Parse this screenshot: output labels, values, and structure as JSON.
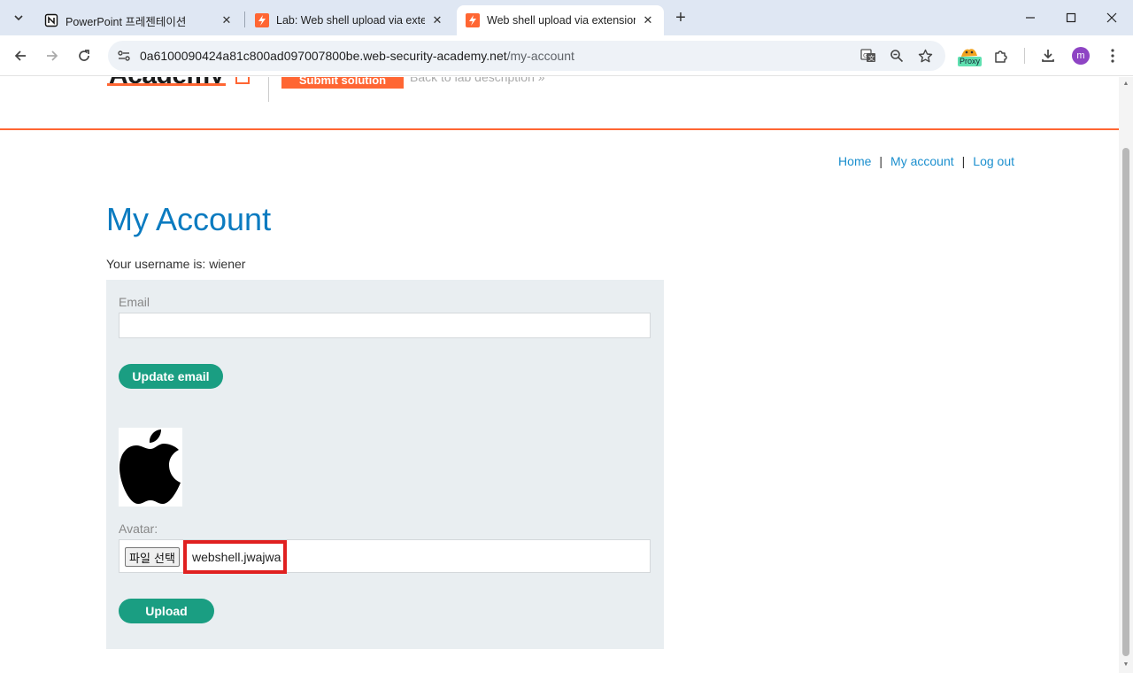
{
  "browser": {
    "tabs": [
      {
        "title": "PowerPoint 프레젠테이션"
      },
      {
        "title": "Lab: Web shell upload via extension"
      },
      {
        "title": "Web shell upload via extension"
      }
    ],
    "url_host": "0a6100090424a81c800ad097007800be.web-security-academy.net",
    "url_path": "/my-account",
    "proxy_label": "Proxy",
    "profile_initial": "m"
  },
  "lab_header": {
    "brand": "Academy",
    "submit_label": "Submit solution",
    "back_link": "Back to lab description  »"
  },
  "nav": {
    "home": "Home",
    "my_account": "My account",
    "logout": "Log out",
    "separator": "|"
  },
  "account": {
    "title": "My Account",
    "username_line": "Your username is: wiener",
    "email_label": "Email",
    "email_value": "",
    "update_email_label": "Update email",
    "avatar_label": "Avatar:",
    "file_button_label": "파일 선택",
    "file_name": "webshell.jwajwa",
    "upload_label": "Upload"
  },
  "colors": {
    "accent_orange": "#ff6633",
    "title_blue": "#0b7bc0",
    "link_blue": "#1b8fce",
    "button_green": "#1a9e82",
    "highlight_red": "#e02020"
  }
}
